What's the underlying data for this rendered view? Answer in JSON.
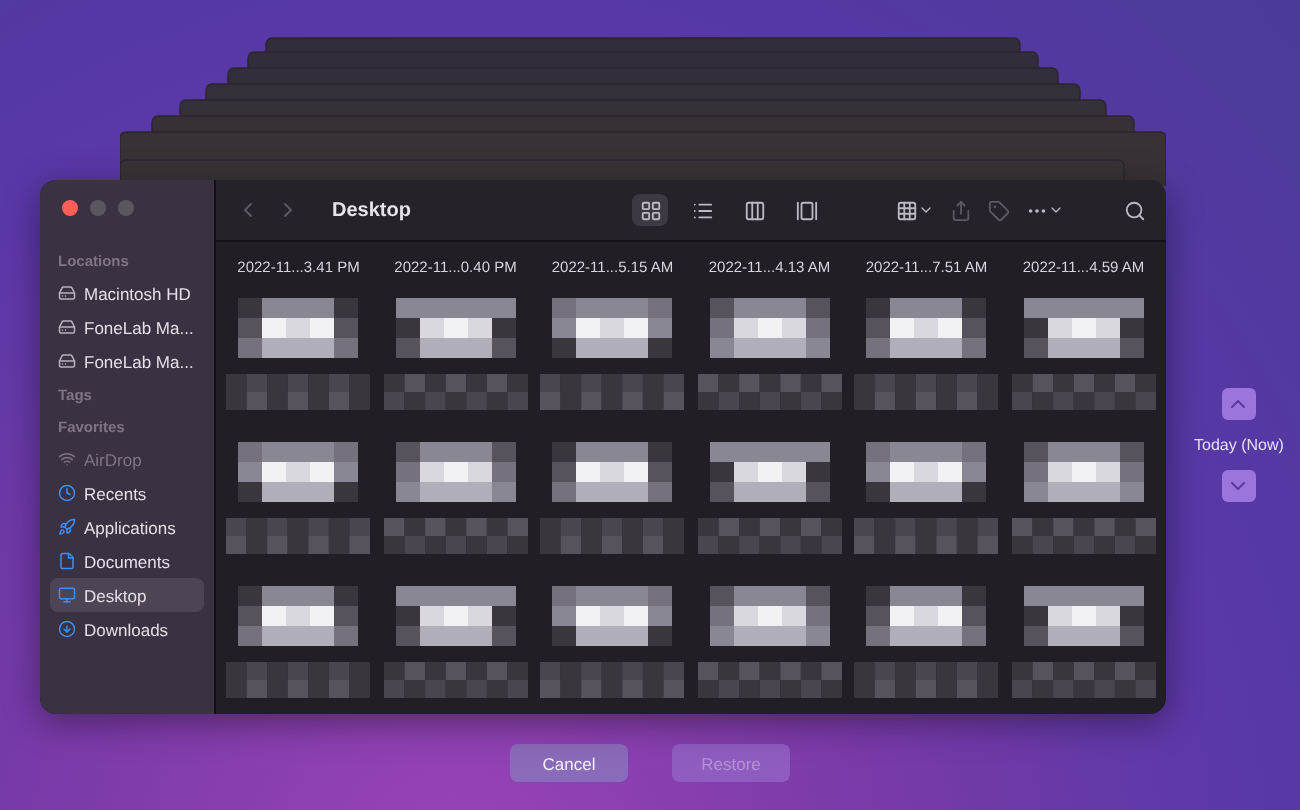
{
  "window": {
    "title": "Desktop"
  },
  "sidebar": [
    {
      "heading": "Locations",
      "items": [
        {
          "label": "Macintosh HD",
          "kind": "drive",
          "selected": false,
          "disabled": false
        },
        {
          "label": "FoneLab Ma...",
          "kind": "drive",
          "selected": false,
          "disabled": false
        },
        {
          "label": "FoneLab Ma...",
          "kind": "drive",
          "selected": false,
          "disabled": false
        }
      ]
    },
    {
      "heading": "Tags"
    },
    {
      "heading": "Favorites",
      "items": [
        {
          "label": "AirDrop",
          "kind": "airdrop",
          "selected": false,
          "disabled": true
        },
        {
          "label": "Recents",
          "kind": "recents",
          "selected": false,
          "disabled": false
        },
        {
          "label": "Applications",
          "kind": "applications",
          "selected": false,
          "disabled": false
        },
        {
          "label": "Documents",
          "kind": "documents",
          "selected": false,
          "disabled": false
        },
        {
          "label": "Desktop",
          "kind": "desktop",
          "selected": true,
          "disabled": false
        },
        {
          "label": "Downloads",
          "kind": "downloads",
          "selected": false,
          "disabled": false
        }
      ]
    }
  ],
  "view_modes": [
    {
      "kind": "icons",
      "selected": true
    },
    {
      "kind": "list",
      "selected": false
    },
    {
      "kind": "columns",
      "selected": false
    },
    {
      "kind": "gallery",
      "selected": false
    }
  ],
  "files": [
    {
      "kind": "captioned",
      "caption": "2022-11...3.41 PM"
    },
    {
      "kind": "captioned",
      "caption": "2022-11...0.40 PM"
    },
    {
      "kind": "captioned",
      "caption": "2022-11...5.15 AM"
    },
    {
      "kind": "captioned",
      "caption": "2022-11...4.13 AM"
    },
    {
      "kind": "captioned",
      "caption": "2022-11...7.51 AM"
    },
    {
      "kind": "captioned",
      "caption": "2022-11...4.59 AM"
    },
    {
      "kind": "plain"
    },
    {
      "kind": "plain"
    },
    {
      "kind": "plain"
    },
    {
      "kind": "plain"
    },
    {
      "kind": "plain"
    },
    {
      "kind": "plain"
    },
    {
      "kind": "plain"
    },
    {
      "kind": "plain"
    },
    {
      "kind": "plain"
    },
    {
      "kind": "plain"
    },
    {
      "kind": "plain"
    },
    {
      "kind": "plain"
    }
  ],
  "timeline": {
    "label": "Today (Now)"
  },
  "buttons": [
    {
      "label": "Cancel",
      "disabled": false
    },
    {
      "label": "Restore",
      "disabled": true
    }
  ]
}
